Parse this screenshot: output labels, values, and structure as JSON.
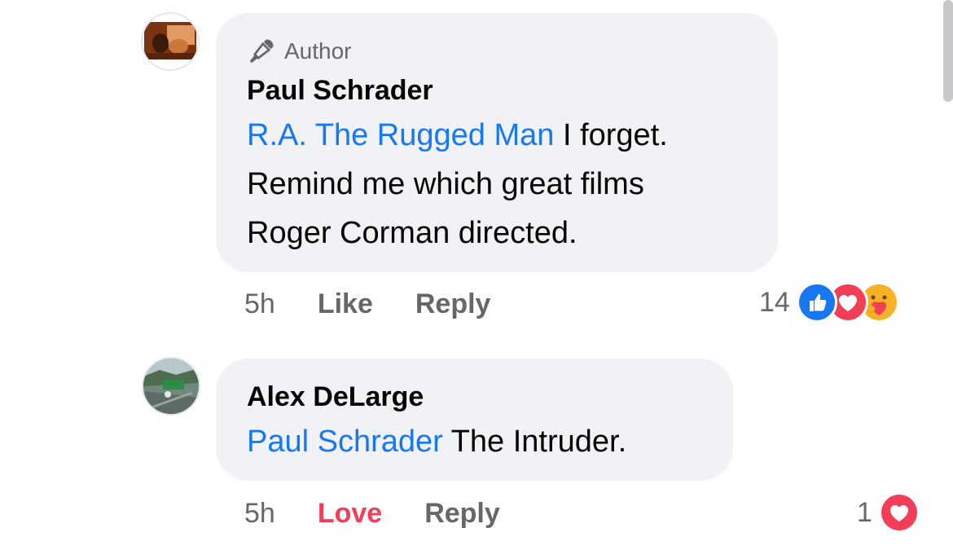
{
  "comments": [
    {
      "author_badge": "Author",
      "name": "Paul Schrader",
      "mention": "R.A. The Rugged Man",
      "text_lines": [
        " I forget.",
        "Remind me which great films",
        "Roger Corman directed."
      ],
      "time": "5h",
      "actions": [
        "Like",
        "Reply"
      ],
      "reaction_count": "14",
      "reactions": [
        "like-icon",
        "love-icon",
        "care-icon"
      ]
    },
    {
      "name": "Alex DeLarge",
      "mention": "Paul Schrader",
      "text_lines": [
        " The Intruder."
      ],
      "time": "5h",
      "actions": [
        "Love",
        "Reply"
      ],
      "reaction_count": "1",
      "reactions": [
        "love-icon"
      ]
    }
  ],
  "colors": {
    "bubble": "#f0f2f5",
    "mention": "#1877f2",
    "love": "#f33e58",
    "like": "#1877f2",
    "muted": "#65676b"
  }
}
